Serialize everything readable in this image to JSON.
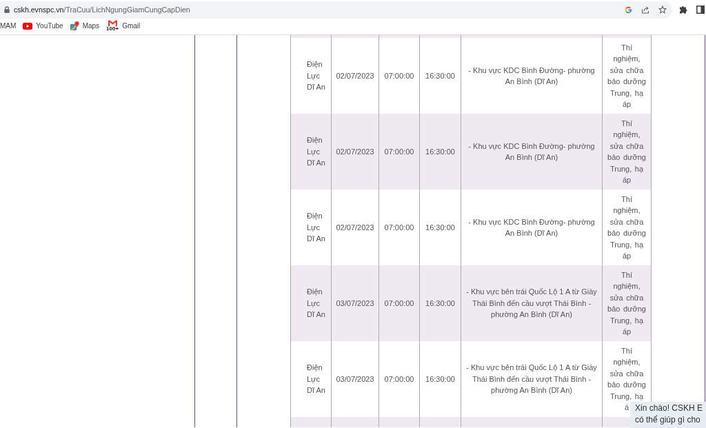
{
  "address_bar": {
    "host": "cskh.evnspc.vn",
    "path": "/TraCuu/LichNgungGiamCungCapDien"
  },
  "bookmarks": [
    {
      "label": "MAM",
      "kind": "plain"
    },
    {
      "label": "YouTube",
      "kind": "video"
    },
    {
      "label": "Maps",
      "kind": "map"
    },
    {
      "label": "Gmail",
      "kind": "mail",
      "badge": "100+"
    }
  ],
  "table": {
    "rows": [
      {
        "unit": "Điện Lực Dĩ An",
        "date": "02/07/2023",
        "start_time": "07:00:00",
        "end_time": "16:30:00",
        "area": "- Khu vực KDC Bình Đường- phường An Bình (Dĩ An)",
        "reason": "Thí nghiệm, sửa chữa bảo dưỡng Trung, hạ áp"
      },
      {
        "unit": "Điện Lực Dĩ An",
        "date": "02/07/2023",
        "start_time": "07:00:00",
        "end_time": "16:30:00",
        "area": "- Khu vực KDC Bình Đường- phường An Bình (Dĩ An)",
        "reason": "Thí nghiệm, sửa chữa bảo dưỡng Trung, hạ áp"
      },
      {
        "unit": "Điện Lực Dĩ An",
        "date": "02/07/2023",
        "start_time": "07:00:00",
        "end_time": "16:30:00",
        "area": "- Khu vực KDC Bình Đường- phường An Bình (Dĩ An)",
        "reason": "Thí nghiệm, sửa chữa bảo dưỡng Trung, hạ áp"
      },
      {
        "unit": "Điện Lực Dĩ An",
        "date": "03/07/2023",
        "start_time": "07:00:00",
        "end_time": "16:30:00",
        "area": "- Khu vực bên trái Quốc Lộ 1 A từ Giày Thái Bình đến cầu vượt Thái Bình - phường An Bình (Dĩ An)",
        "reason": "Thí nghiệm, sửa chữa bảo dưỡng Trung, hạ áp"
      },
      {
        "unit": "Điện Lực Dĩ An",
        "date": "03/07/2023",
        "start_time": "07:00:00",
        "end_time": "16:30:00",
        "area": "- Khu vực bên trái Quốc Lộ 1 A từ Giày Thái Bình đến cầu vượt Thái Bình - phường An Bình (Dĩ An)",
        "reason": "Thí nghiệm, sửa chữa bảo dưỡng Trung, hạ á"
      }
    ]
  },
  "chat_bubble": {
    "lines": [
      "Xin chào! CSKH E",
      "có thể giúp gì cho"
    ]
  }
}
